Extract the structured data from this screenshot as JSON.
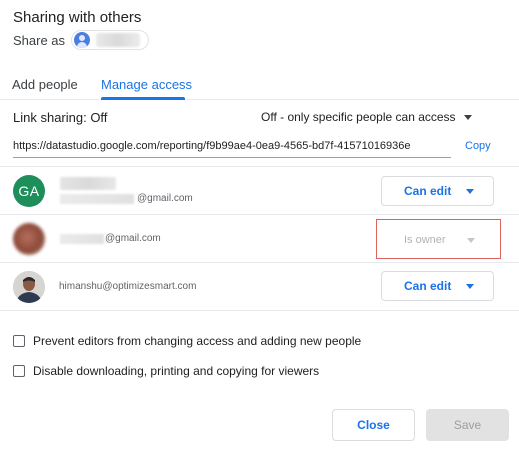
{
  "dialog": {
    "title": "Sharing with others",
    "share_as_label": "Share as"
  },
  "tabs": [
    {
      "label": "Add people",
      "active": false
    },
    {
      "label": "Manage access",
      "active": true
    }
  ],
  "link_sharing": {
    "label": "Link sharing: Off",
    "option": "Off - only specific people can access",
    "url": "https://datastudio.google.com/reporting/f9b99ae4-0ea9-4565-bd7f-41571016936e",
    "copy_label": "Copy"
  },
  "people": [
    {
      "initials": "GA",
      "email": "@gmail.com",
      "role": "Can edit",
      "avatar_color": "#1e8e5a"
    },
    {
      "email": "@gmail.com",
      "role": "Is owner"
    },
    {
      "email": "himanshu@optimizesmart.com",
      "role": "Can edit"
    }
  ],
  "options": [
    {
      "label": "Prevent editors from changing access and adding new people",
      "checked": false
    },
    {
      "label": "Disable downloading, printing and copying for viewers",
      "checked": false
    }
  ],
  "buttons": {
    "close_label": "Close",
    "save_label": "Save"
  },
  "colors": {
    "accent": "#1a73e8",
    "highlight_border": "#e0625f"
  },
  "icons": {
    "share_as_avatar": "account-circle-icon",
    "dropdown": "caret-down-icon"
  }
}
